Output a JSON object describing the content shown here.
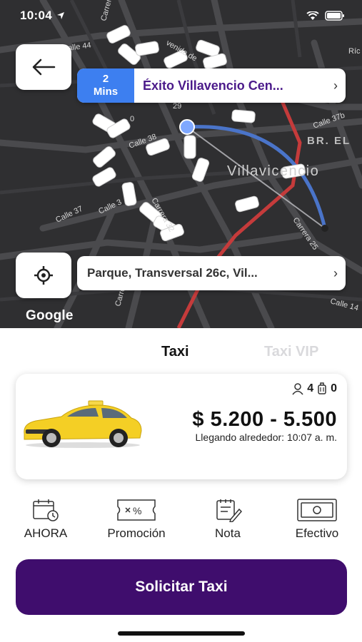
{
  "status_bar": {
    "time": "10:04"
  },
  "map": {
    "eta_value": "2",
    "eta_unit": "Mins",
    "destination": "Éxito Villavencio Cen...",
    "origin": "Parque, Transversal 26c,  Vil...",
    "attribution": "Google",
    "street_labels": {
      "calle44": "Calle 44",
      "avenida": "venida de",
      "carrera_top": "Carrera",
      "calle38": "Calle 38",
      "calle37b": "Calle 37b",
      "br_el": "BR. EL",
      "villavicencio": "Villavicencio",
      "calle37": "Calle 37",
      "calle36": "Calle 3",
      "carrera32": "Carrera 32",
      "carrera25": "Carrera 25",
      "carrera40": "Carrera 40",
      "calle14": "Calle 14",
      "ric": "Ríc",
      "n29": "29",
      "n0": "0"
    }
  },
  "tabs": {
    "taxi": "Taxi",
    "taxi_vip": "Taxi VIP"
  },
  "ride": {
    "passengers": "4",
    "luggage": "0",
    "price": "$ 5.200 - 5.500",
    "arrival": "Llegando alrededor: 10:07 a. m."
  },
  "options": {
    "now": "AHORA",
    "promo": "Promoción",
    "note": "Nota",
    "payment": "Efectivo"
  },
  "cta": {
    "label": "Solicitar Taxi"
  },
  "colors": {
    "accent_purple": "#3f0d6d",
    "eta_blue": "#3d7ff0",
    "destination_text": "#4b1a8a",
    "map_bg": "#2f2f31",
    "route_red": "#c53b3b",
    "route_blue": "#4a74c9"
  }
}
